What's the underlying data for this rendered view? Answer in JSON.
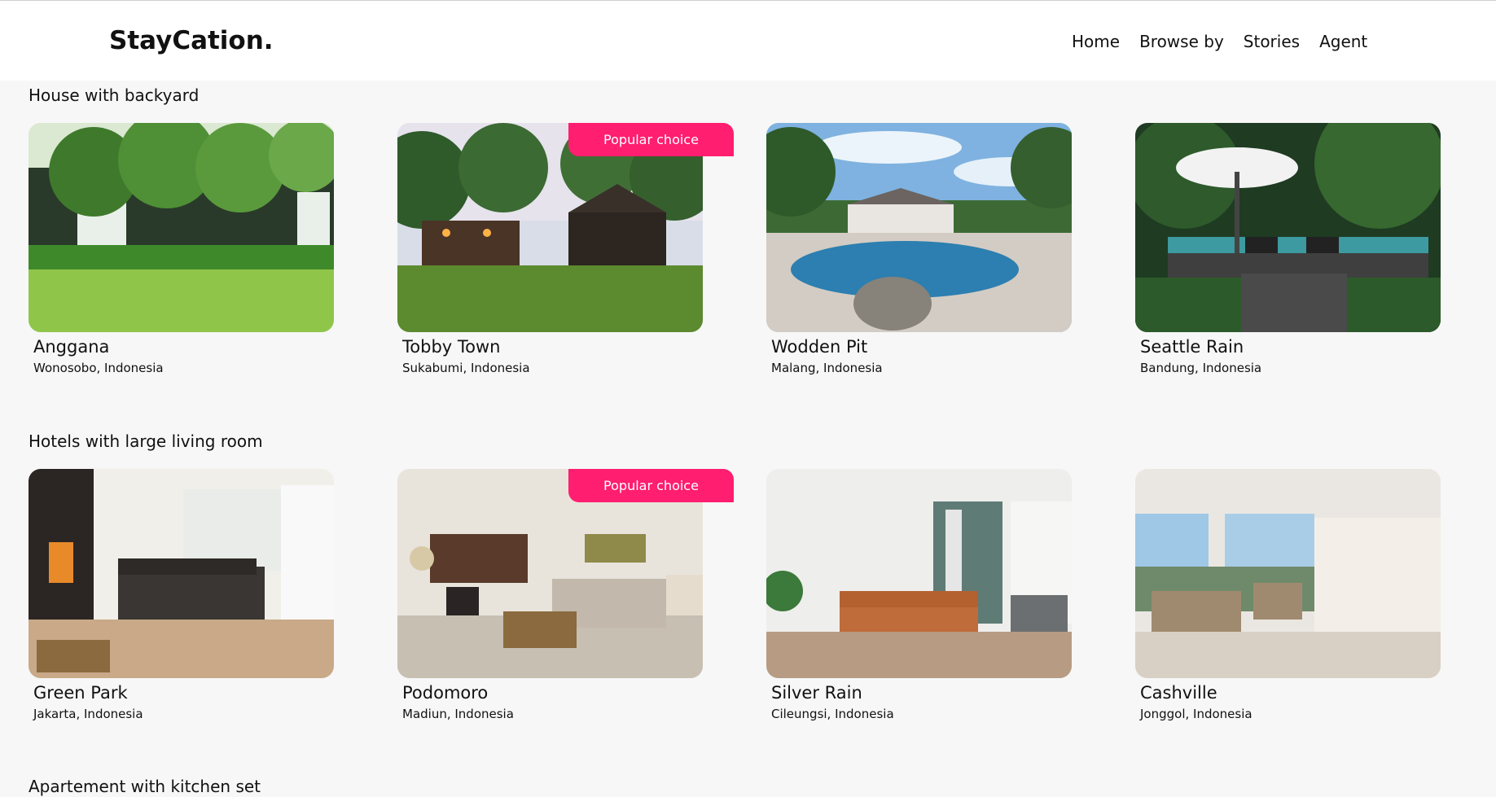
{
  "brand": "StayCation.",
  "nav": [
    "Home",
    "Browse by",
    "Stories",
    "Agent"
  ],
  "sections": [
    {
      "title": "House with backyard",
      "items": [
        {
          "name": "Anggana",
          "location": "Wonosobo, Indonesia",
          "badge": ""
        },
        {
          "name": "Tobby Town",
          "location": "Sukabumi, Indonesia",
          "badge": "Popular choice"
        },
        {
          "name": "Wodden Pit",
          "location": "Malang, Indonesia",
          "badge": ""
        },
        {
          "name": "Seattle Rain",
          "location": "Bandung, Indonesia",
          "badge": ""
        }
      ]
    },
    {
      "title": "Hotels with large living room",
      "items": [
        {
          "name": "Green Park",
          "location": "Jakarta, Indonesia",
          "badge": ""
        },
        {
          "name": "Podomoro",
          "location": "Madiun, Indonesia",
          "badge": "Popular choice"
        },
        {
          "name": "Silver Rain",
          "location": "Cileungsi, Indonesia",
          "badge": ""
        },
        {
          "name": "Cashville",
          "location": "Jonggol, Indonesia",
          "badge": ""
        }
      ]
    },
    {
      "title": "Apartement with kitchen set",
      "items": []
    }
  ],
  "colors": {
    "badge": "#ff1e6f",
    "background": "#f7f7f7",
    "navbar": "#ffffff",
    "text": "#111111"
  }
}
